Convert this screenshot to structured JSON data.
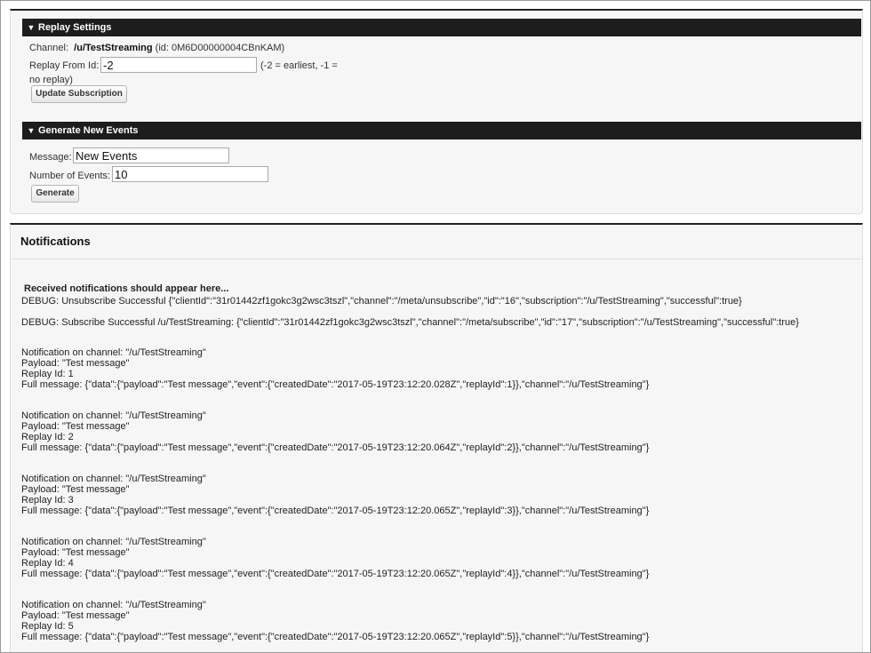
{
  "replay_settings": {
    "header": "Replay Settings",
    "channel_label": "Channel:",
    "channel_name": "/u/TestStreaming",
    "channel_id": "(id:  0M6D00000004CBnKAM)",
    "replay_from_label": "Replay From Id:",
    "replay_from_value": "-2",
    "hint_line1": "(-2 = earliest, -1 =",
    "hint_line2": "no replay)",
    "update_button": "Update Subscription"
  },
  "generate_events": {
    "header": "Generate New Events",
    "message_label": "Message:",
    "message_value": "New Events",
    "count_label": "Number of Events:",
    "count_value": "10",
    "generate_button": "Generate"
  },
  "notifications": {
    "title": "Notifications",
    "intro": "Received notifications should appear here...",
    "debug_lines": [
      "DEBUG: Unsubscribe Successful {\"clientId\":\"31r01442zf1gokc3g2wsc3tszl\",\"channel\":\"/meta/unsubscribe\",\"id\":\"16\",\"subscription\":\"/u/TestStreaming\",\"successful\":true}",
      "DEBUG: Subscribe Successful /u/TestStreaming: {\"clientId\":\"31r01442zf1gokc3g2wsc3tszl\",\"channel\":\"/meta/subscribe\",\"id\":\"17\",\"subscription\":\"/u/TestStreaming\",\"successful\":true}"
    ],
    "items": [
      {
        "channel": "Notification on channel: \"/u/TestStreaming\"",
        "payload": "Payload: \"Test message\"",
        "replay": "Replay Id: 1",
        "full": "Full message: {\"data\":{\"payload\":\"Test message\",\"event\":{\"createdDate\":\"2017-05-19T23:12:20.028Z\",\"replayId\":1}},\"channel\":\"/u/TestStreaming\"}"
      },
      {
        "channel": "Notification on channel: \"/u/TestStreaming\"",
        "payload": "Payload: \"Test message\"",
        "replay": "Replay Id: 2",
        "full": "Full message: {\"data\":{\"payload\":\"Test message\",\"event\":{\"createdDate\":\"2017-05-19T23:12:20.064Z\",\"replayId\":2}},\"channel\":\"/u/TestStreaming\"}"
      },
      {
        "channel": "Notification on channel: \"/u/TestStreaming\"",
        "payload": "Payload: \"Test message\"",
        "replay": "Replay Id: 3",
        "full": "Full message: {\"data\":{\"payload\":\"Test message\",\"event\":{\"createdDate\":\"2017-05-19T23:12:20.065Z\",\"replayId\":3}},\"channel\":\"/u/TestStreaming\"}"
      },
      {
        "channel": "Notification on channel: \"/u/TestStreaming\"",
        "payload": "Payload: \"Test message\"",
        "replay": "Replay Id: 4",
        "full": "Full message: {\"data\":{\"payload\":\"Test message\",\"event\":{\"createdDate\":\"2017-05-19T23:12:20.065Z\",\"replayId\":4}},\"channel\":\"/u/TestStreaming\"}"
      },
      {
        "channel": "Notification on channel: \"/u/TestStreaming\"",
        "payload": "Payload: \"Test message\"",
        "replay": "Replay Id: 5",
        "full": "Full message: {\"data\":{\"payload\":\"Test message\",\"event\":{\"createdDate\":\"2017-05-19T23:12:20.065Z\",\"replayId\":5}},\"channel\":\"/u/TestStreaming\"}"
      }
    ]
  }
}
